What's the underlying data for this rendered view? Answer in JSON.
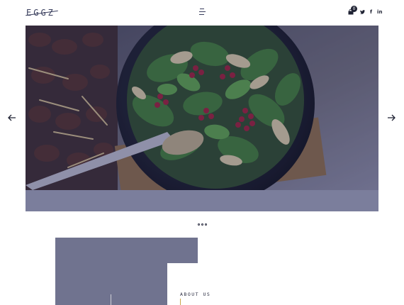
{
  "header": {
    "logo_text": "EGGZ",
    "cart_count": "0",
    "social": [
      "twitter",
      "f",
      "in"
    ]
  },
  "hero": {
    "image_description": "salad bowl with spinach, pomegranate seeds and grilled chicken beside meat skewers",
    "overlay_color": "#282a5a"
  },
  "slider": {
    "prev_icon": "arrow-left-icon",
    "next_icon": "arrow-right-icon",
    "dots_count": 3
  },
  "about": {
    "title": "ABOUT US"
  },
  "colors": {
    "brand_dark": "#2a2c40",
    "band": "#7b7e9c",
    "accent": "#c9a64a"
  }
}
